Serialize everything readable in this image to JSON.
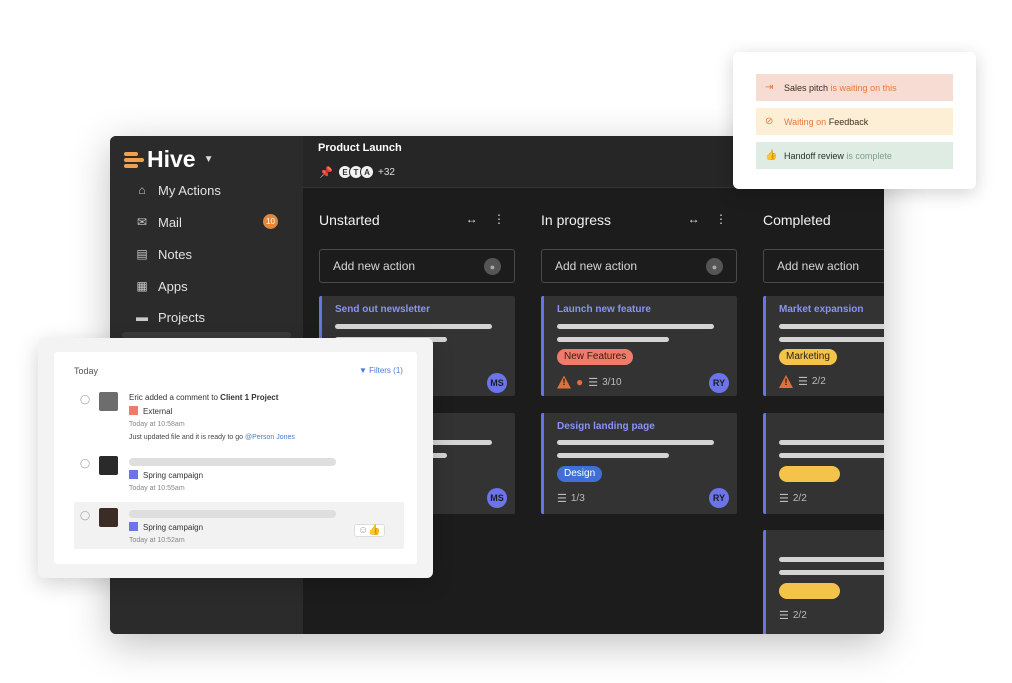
{
  "app": {
    "logo": "Hive",
    "project_title": "Product Launch",
    "collaborators": [
      "E",
      "T",
      "A"
    ],
    "collaborators_more": "+32"
  },
  "sidebar": {
    "items": [
      {
        "label": "My Actions",
        "icon": "home-icon"
      },
      {
        "label": "Mail",
        "icon": "mail-icon",
        "badge": "10"
      },
      {
        "label": "Notes",
        "icon": "notes-icon"
      },
      {
        "label": "Apps",
        "icon": "apps-icon"
      },
      {
        "label": "Projects",
        "icon": "folder-icon"
      }
    ]
  },
  "board": {
    "add_action_label": "Add new action",
    "columns": [
      {
        "title": "Unstarted",
        "cards": [
          {
            "title": "Send out newsletter",
            "assignee": "MS"
          },
          {
            "title": "",
            "assignee": "MS"
          }
        ]
      },
      {
        "title": "In progress",
        "cards": [
          {
            "title": "Launch new feature",
            "tag": "New Features",
            "checklist": "3/10",
            "assignee": "RY"
          },
          {
            "title": "Design landing page",
            "tag": "Design",
            "checklist": "1/3",
            "assignee": "RY"
          }
        ]
      },
      {
        "title": "Completed",
        "cards": [
          {
            "title": "Market expansion",
            "tag": "Marketing",
            "checklist": "2/2"
          },
          {
            "title": "",
            "checklist": "2/2"
          },
          {
            "title": "",
            "checklist": "2/2"
          }
        ]
      }
    ]
  },
  "status_popup": {
    "rows": [
      {
        "subject": "Sales pitch",
        "status": "is waiting on this",
        "color": "#f7dcd3"
      },
      {
        "prefix": "Waiting on",
        "subject": "Feedback",
        "color": "#fcefd5"
      },
      {
        "subject": "Handoff review",
        "status": "is complete",
        "color": "#dfece3"
      }
    ]
  },
  "activity": {
    "heading": "Today",
    "filters_label": "Filters (1)",
    "items": [
      {
        "prefix": "Eric added a comment to",
        "project": "Client 1 Project",
        "label": "External",
        "time": "Today at 10:58am",
        "message": "Just updated file and it is ready to go",
        "mention": "@Person Jones"
      },
      {
        "label": "Spring campaign",
        "time": "Today at 10:55am"
      },
      {
        "label": "Spring campaign",
        "time": "Today at 10:52am"
      }
    ]
  }
}
